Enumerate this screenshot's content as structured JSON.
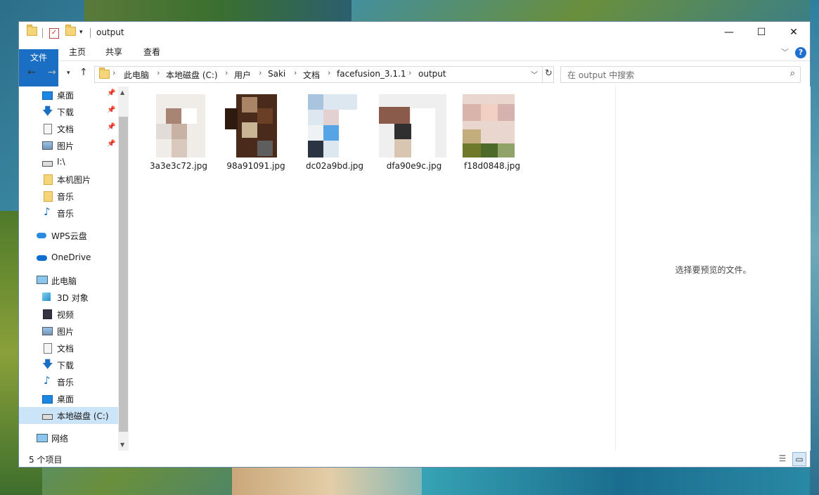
{
  "window": {
    "title": "output",
    "controls": {
      "minimize": "—",
      "maximize": "☐",
      "close": "✕"
    }
  },
  "ribbon": {
    "tabs": [
      "文件",
      "主页",
      "共享",
      "查看"
    ],
    "help": "?"
  },
  "address": {
    "crumbs": [
      "此电脑",
      "本地磁盘 (C:)",
      "用户",
      "Saki",
      "文档",
      "facefusion_3.1.1",
      "output"
    ]
  },
  "search": {
    "placeholder": "在 output 中搜索"
  },
  "nav": {
    "items": [
      {
        "label": "桌面",
        "icon": "desktop-icon",
        "pinned": true
      },
      {
        "label": "下载",
        "icon": "download-icon",
        "pinned": true
      },
      {
        "label": "文档",
        "icon": "document-icon",
        "pinned": true
      },
      {
        "label": "图片",
        "icon": "pictures-icon",
        "pinned": true
      },
      {
        "label": "I:\\",
        "icon": "drive-icon",
        "pinned": false
      },
      {
        "label": "本机图片",
        "icon": "folder-icon",
        "pinned": false
      },
      {
        "label": "音乐",
        "icon": "folder-icon",
        "pinned": false
      },
      {
        "label": "音乐",
        "icon": "music-icon",
        "pinned": false
      },
      {
        "label": "WPS云盘",
        "icon": "cloud-icon",
        "pinned": false
      },
      {
        "label": "OneDrive",
        "icon": "onedrive-icon",
        "pinned": false
      },
      {
        "label": "此电脑",
        "icon": "computer-icon",
        "pinned": false
      },
      {
        "label": "3D 对象",
        "icon": "3d-objects-icon",
        "pinned": false
      },
      {
        "label": "视频",
        "icon": "video-icon",
        "pinned": false
      },
      {
        "label": "图片",
        "icon": "pictures-icon",
        "pinned": false
      },
      {
        "label": "文档",
        "icon": "document-icon",
        "pinned": false
      },
      {
        "label": "下载",
        "icon": "download-icon",
        "pinned": false
      },
      {
        "label": "音乐",
        "icon": "music-icon",
        "pinned": false
      },
      {
        "label": "桌面",
        "icon": "desktop-icon",
        "pinned": false
      },
      {
        "label": "本地磁盘 (C:)",
        "icon": "disk-icon",
        "pinned": false,
        "selected": true
      },
      {
        "label": "网络",
        "icon": "network-icon",
        "pinned": false
      }
    ]
  },
  "files": [
    {
      "name": "3a3e3c72.jpg"
    },
    {
      "name": "98a91091.jpg"
    },
    {
      "name": "dc02a9bd.jpg"
    },
    {
      "name": "dfa90e9c.jpg"
    },
    {
      "name": "f18d0848.jpg"
    }
  ],
  "preview": {
    "text": "选择要预览的文件。"
  },
  "status": {
    "count": "5 个项目"
  },
  "colors": {
    "accent": "#1a6fc4",
    "selected": "#cce4f7"
  }
}
